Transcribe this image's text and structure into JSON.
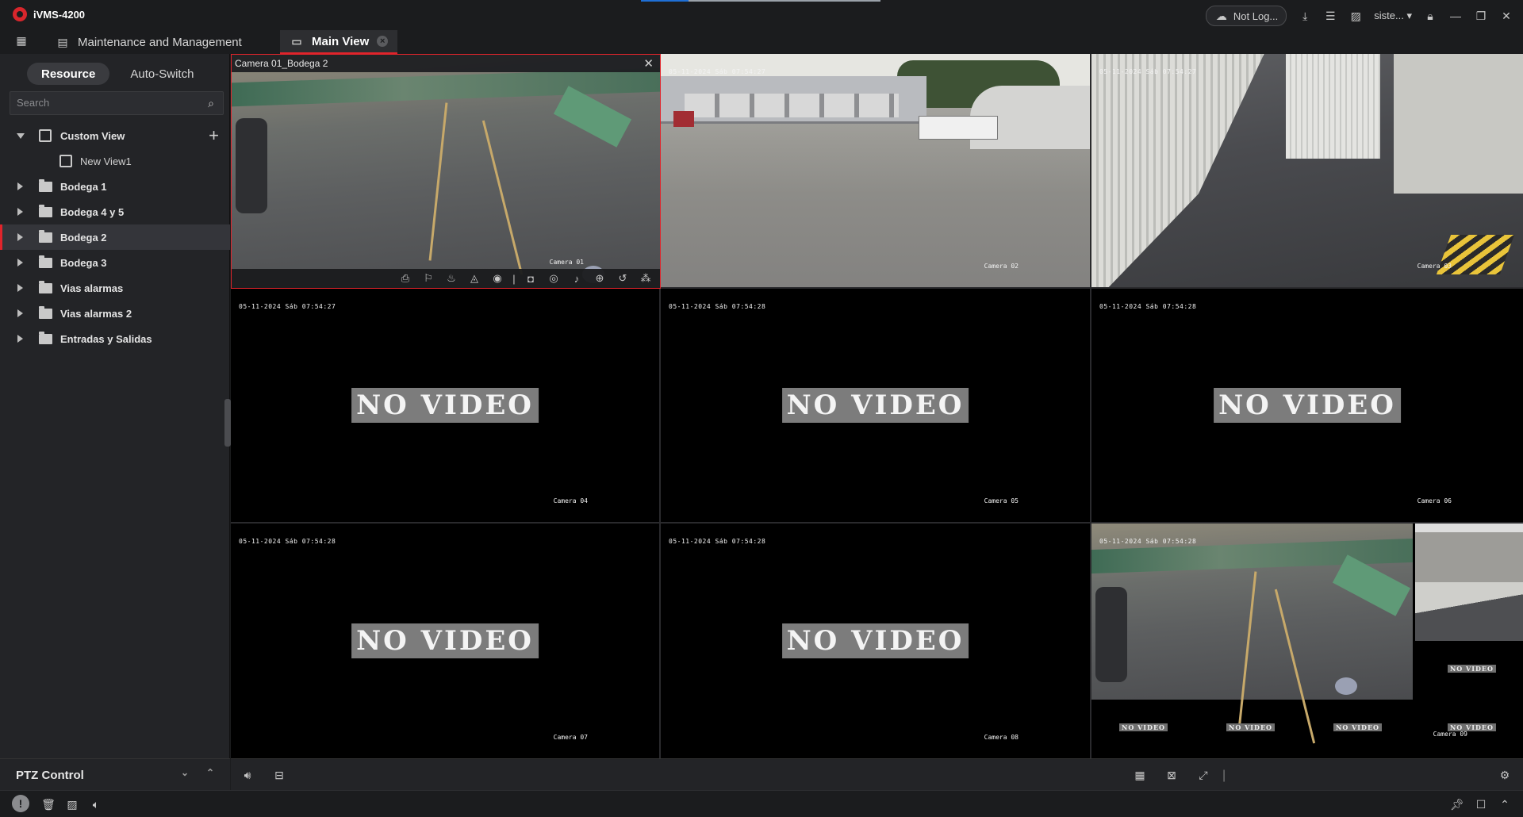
{
  "app": {
    "name": "iVMS-4200",
    "login_status": "Not Log...",
    "user": "siste..."
  },
  "tabs": [
    {
      "label": "Maintenance and Management"
    },
    {
      "label": "Main View"
    }
  ],
  "sidebar": {
    "segments": [
      "Resource",
      "Auto-Switch"
    ],
    "active_segment": "Resource",
    "search_placeholder": "Search",
    "tree": [
      {
        "label": "Custom View",
        "type": "view-group",
        "expanded": true
      },
      {
        "label": "New View1",
        "type": "view"
      },
      {
        "label": "Bodega 1",
        "type": "folder"
      },
      {
        "label": "Bodega 4 y 5",
        "type": "folder"
      },
      {
        "label": "Bodega 2",
        "type": "folder",
        "selected": true
      },
      {
        "label": "Bodega 3",
        "type": "folder"
      },
      {
        "label": "Vias alarmas",
        "type": "folder"
      },
      {
        "label": "Vias alarmas 2",
        "type": "folder"
      },
      {
        "label": "Entradas y Salidas",
        "type": "folder"
      }
    ],
    "ptz_label": "PTZ Control"
  },
  "grid": {
    "selected_title": "Camera 01_Bodega 2",
    "tiles": [
      {
        "cam": "Camera 01",
        "time": "",
        "novideo": false
      },
      {
        "cam": "Camera 02",
        "time": "05-11-2024 Sáb 07:54:27",
        "novideo": false
      },
      {
        "cam": "Camera 03",
        "time": "05-11-2024 Sáb 07:54:27",
        "novideo": false
      },
      {
        "cam": "Camera 04",
        "time": "05-11-2024 Sáb 07:54:27",
        "novideo": true
      },
      {
        "cam": "Camera 05",
        "time": "05-11-2024 Sáb 07:54:28",
        "novideo": true
      },
      {
        "cam": "Camera 06",
        "time": "05-11-2024 Sáb 07:54:28",
        "novideo": true
      },
      {
        "cam": "Camera 07",
        "time": "05-11-2024 Sáb 07:54:28",
        "novideo": true
      },
      {
        "cam": "Camera 08",
        "time": "05-11-2024 Sáb 07:54:28",
        "novideo": true
      },
      {
        "cam": "Camera 09",
        "time": "05-11-2024 Sáb 07:54:28",
        "novideo": false
      }
    ],
    "no_video_text": "NO VIDEO"
  },
  "colors": {
    "accent": "#e1242b",
    "tab_active_bg": "#2d2e31",
    "panel_bg": "#232427",
    "app_bg": "#1b1c1e"
  }
}
